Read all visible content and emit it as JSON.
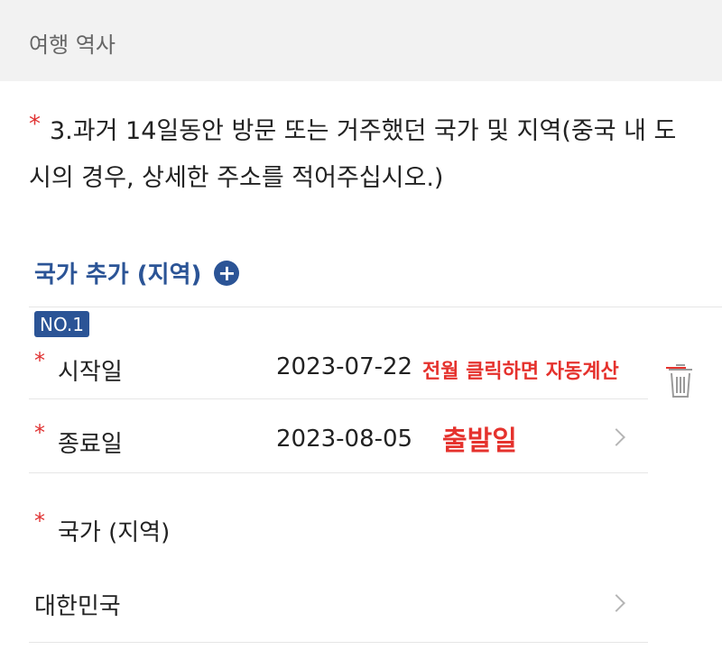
{
  "header": {
    "title": "여행 역사"
  },
  "question": {
    "star": "*",
    "text": "3.과거 14일동안 방문 또는 거주했던 국가 및 지역(중국 내 도시의 경우, 상세한 주소를 적어주십시오.)"
  },
  "add_country": {
    "label": "국가 추가 (지역)",
    "icon": "plus-circle-icon"
  },
  "entry": {
    "badge": "NO.1",
    "start": {
      "star": "*",
      "label": "시작일",
      "value": "2023-07-22"
    },
    "end": {
      "star": "*",
      "label": "종료일",
      "value": "2023-08-05"
    },
    "country": {
      "star": "*",
      "label": "국가 (지역)",
      "value": "대한민국"
    }
  },
  "annotations": {
    "start_note": "전월 클릭하면 자동계산",
    "end_note": "출발일"
  },
  "colors": {
    "accent": "#2b5496",
    "required": "#e03131",
    "annotation": "#e5322d",
    "header_bg": "#f2f2f2"
  }
}
